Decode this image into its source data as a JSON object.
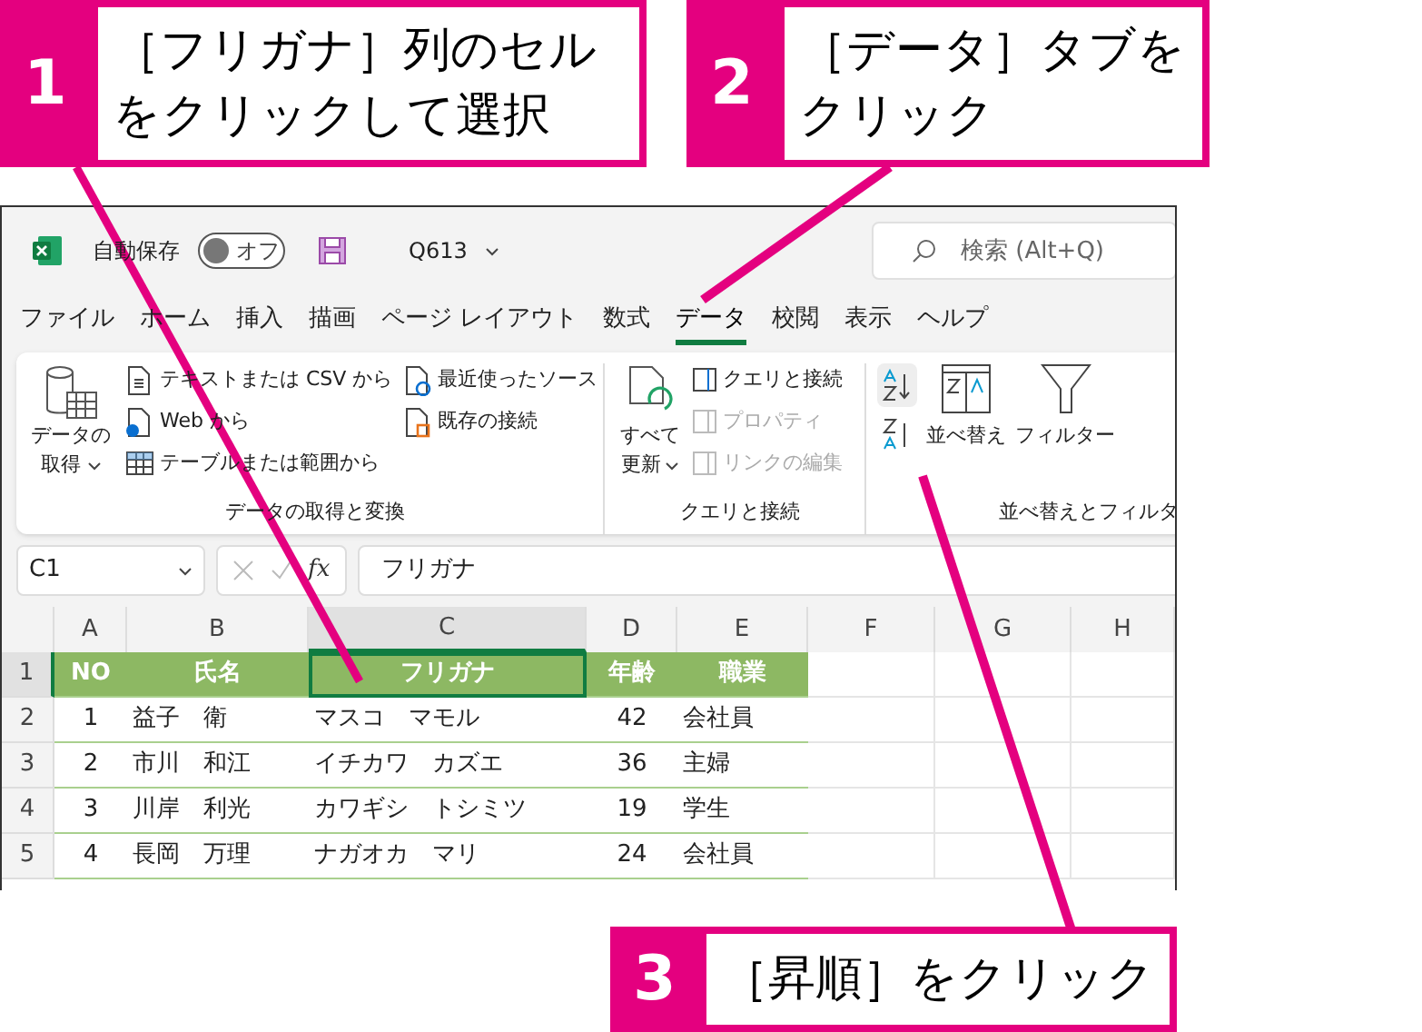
{
  "callouts": [
    {
      "number": "1",
      "lines": [
        "［フリガナ］列のセル",
        "をクリックして選択"
      ]
    },
    {
      "number": "2",
      "lines": [
        "［データ］タブを",
        "クリック"
      ]
    },
    {
      "number": "3",
      "lines": [
        "［昇順］をクリック"
      ]
    }
  ],
  "title_bar": {
    "autosave_label": "自動保存",
    "autosave": {
      "on": false,
      "label": "オフ"
    },
    "file_name": "Q613",
    "search_placeholder": "検索 (Alt+Q)"
  },
  "menu_tabs": [
    {
      "label": "ファイル",
      "selected": false
    },
    {
      "label": "ホーム",
      "selected": false
    },
    {
      "label": "挿入",
      "selected": false
    },
    {
      "label": "描画",
      "selected": false
    },
    {
      "label": "ページ レイアウト",
      "selected": false
    },
    {
      "label": "数式",
      "selected": false
    },
    {
      "label": "データ",
      "selected": true
    },
    {
      "label": "校閲",
      "selected": false
    },
    {
      "label": "表示",
      "selected": false
    },
    {
      "label": "ヘルプ",
      "selected": false
    }
  ],
  "ribbon": {
    "get_data": {
      "label": "データの取得と変換",
      "big_button": [
        "データの",
        "取得"
      ],
      "items": [
        {
          "label": "テキストまたは CSV から",
          "kind": "text-file"
        },
        {
          "label": "Web から",
          "kind": "web"
        },
        {
          "label": "テーブルまたは範囲から",
          "kind": "table"
        },
        {
          "label": "最近使ったソース",
          "kind": "recent"
        },
        {
          "label": "既存の接続",
          "kind": "connection"
        }
      ]
    },
    "queries": {
      "label": "クエリと接続",
      "big_button": [
        "すべて",
        "更新"
      ],
      "items": [
        {
          "label": "クエリと接続",
          "disabled": false
        },
        {
          "label": "プロパティ",
          "disabled": true
        },
        {
          "label": "リンクの編集",
          "disabled": true
        }
      ]
    },
    "sort_filter": {
      "label": "並べ替えとフィルタ",
      "sort_ascending": {
        "highlighted": true
      },
      "sort_button": "並べ替え",
      "filter_button": "フィルター"
    }
  },
  "formula_bar": {
    "name_box": "C1",
    "function_label": "fx",
    "formula": "フリガナ"
  },
  "sheet": {
    "columns": [
      {
        "label": "A",
        "selected": false
      },
      {
        "label": "B",
        "selected": false
      },
      {
        "label": "C",
        "selected": true
      },
      {
        "label": "D",
        "selected": false
      },
      {
        "label": "E",
        "selected": false
      },
      {
        "label": "F",
        "selected": false
      },
      {
        "label": "G",
        "selected": false
      },
      {
        "label": "H",
        "selected": false
      }
    ],
    "rows": [
      {
        "number": "1",
        "header": true,
        "selected": true,
        "cells": [
          "NO",
          "氏名",
          "フリガナ",
          "年齢",
          "職業"
        ]
      },
      {
        "number": "2",
        "header": false,
        "selected": false,
        "cells": [
          "1",
          "益子　衛",
          "マスコ　マモル",
          "42",
          "会社員"
        ]
      },
      {
        "number": "3",
        "header": false,
        "selected": false,
        "cells": [
          "2",
          "市川　和江",
          "イチカワ　カズエ",
          "36",
          "主婦"
        ]
      },
      {
        "number": "4",
        "header": false,
        "selected": false,
        "cells": [
          "3",
          "川岸　利光",
          "カワギシ　トシミツ",
          "19",
          "学生"
        ]
      },
      {
        "number": "5",
        "header": false,
        "selected": false,
        "cells": [
          "4",
          "長岡　万理",
          "ナガオカ　マリ",
          "24",
          "会社員"
        ]
      }
    ]
  }
}
